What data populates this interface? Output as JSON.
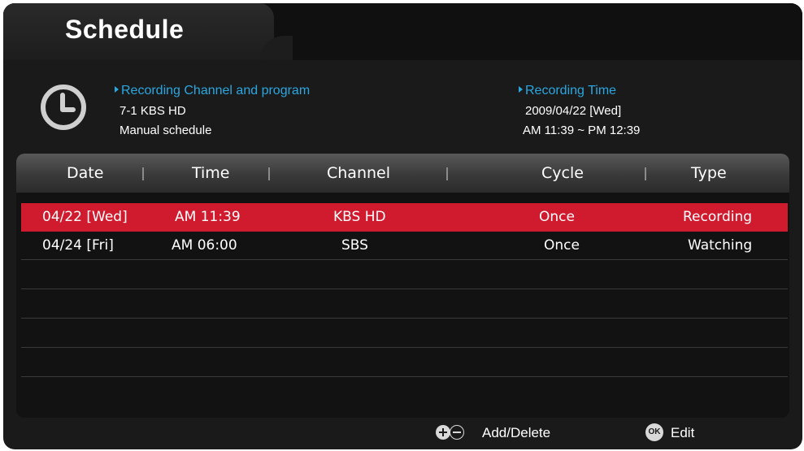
{
  "title": "Schedule",
  "info": {
    "channel_label": "Recording Channel and program",
    "channel_value": "7-1 KBS HD",
    "program_value": "Manual schedule",
    "time_label": "Recording Time",
    "date_value": "2009/04/22 [Wed]",
    "time_value": "AM 11:39 ~ PM 12:39"
  },
  "columns": [
    "Date",
    "Time",
    "Channel",
    "Cycle",
    "Type"
  ],
  "rows": [
    {
      "date": "04/22 [Wed]",
      "time": "AM 11:39",
      "channel": "KBS HD",
      "cycle": "Once",
      "type": "Recording",
      "selected": true
    },
    {
      "date": "04/24 [Fri]",
      "time": "AM 06:00",
      "channel": "SBS",
      "cycle": "Once",
      "type": "Watching",
      "selected": false
    }
  ],
  "footer": {
    "add_delete_label": "Add/Delete",
    "edit_label": "Edit",
    "ok_icon_text": "OK"
  },
  "colors": {
    "accent": "#2aa7e1",
    "selection": "#d01a2e",
    "background": "#1a1a1a"
  },
  "icons": [
    "clock-icon",
    "add-icon",
    "delete-icon",
    "ok-icon"
  ]
}
